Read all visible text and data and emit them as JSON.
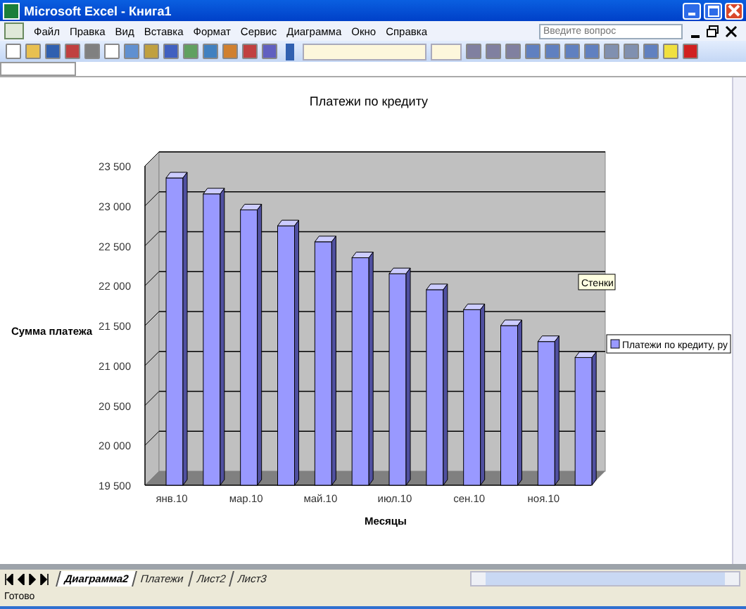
{
  "window": {
    "title": "Microsoft Excel - Книга1"
  },
  "menu": [
    "Файл",
    "Правка",
    "Вид",
    "Вставка",
    "Формат",
    "Сервис",
    "Диаграмма",
    "Окно",
    "Справка"
  ],
  "help_box": {
    "placeholder": "Введите вопрос"
  },
  "chart": {
    "tooltip": "Стенки",
    "chart_data": {
      "type": "bar",
      "title": "Платежи по кредиту",
      "xlabel": "Месяцы",
      "ylabel": "Сумма платежа",
      "ylim": [
        19500,
        23500
      ],
      "yticks": [
        {
          "value": 19500,
          "label": "19 500"
        },
        {
          "value": 20000,
          "label": "20 000"
        },
        {
          "value": 20500,
          "label": "20 500"
        },
        {
          "value": 21000,
          "label": "21 000"
        },
        {
          "value": 21500,
          "label": "21 500"
        },
        {
          "value": 22000,
          "label": "22 000"
        },
        {
          "value": 22500,
          "label": "22 500"
        },
        {
          "value": 23000,
          "label": "23 000"
        },
        {
          "value": 23500,
          "label": "23 500"
        }
      ],
      "categories": [
        "янв.10",
        null,
        "мар.10",
        null,
        "май.10",
        null,
        "июл.10",
        null,
        "сен.10",
        null,
        "ноя.10",
        null
      ],
      "series": [
        {
          "name": "Платежи по кредиту, ру",
          "color": "#9999ff",
          "values": [
            23350,
            23150,
            22950,
            22750,
            22550,
            22350,
            22150,
            21950,
            21700,
            21500,
            21300,
            21100
          ]
        }
      ]
    }
  },
  "sheet_tabs": [
    {
      "label": "Диаграмма2",
      "selected": true
    },
    {
      "label": "Платежи",
      "selected": false
    },
    {
      "label": "Лист2",
      "selected": false
    },
    {
      "label": "Лист3",
      "selected": false
    }
  ],
  "status_bar": "Готово"
}
